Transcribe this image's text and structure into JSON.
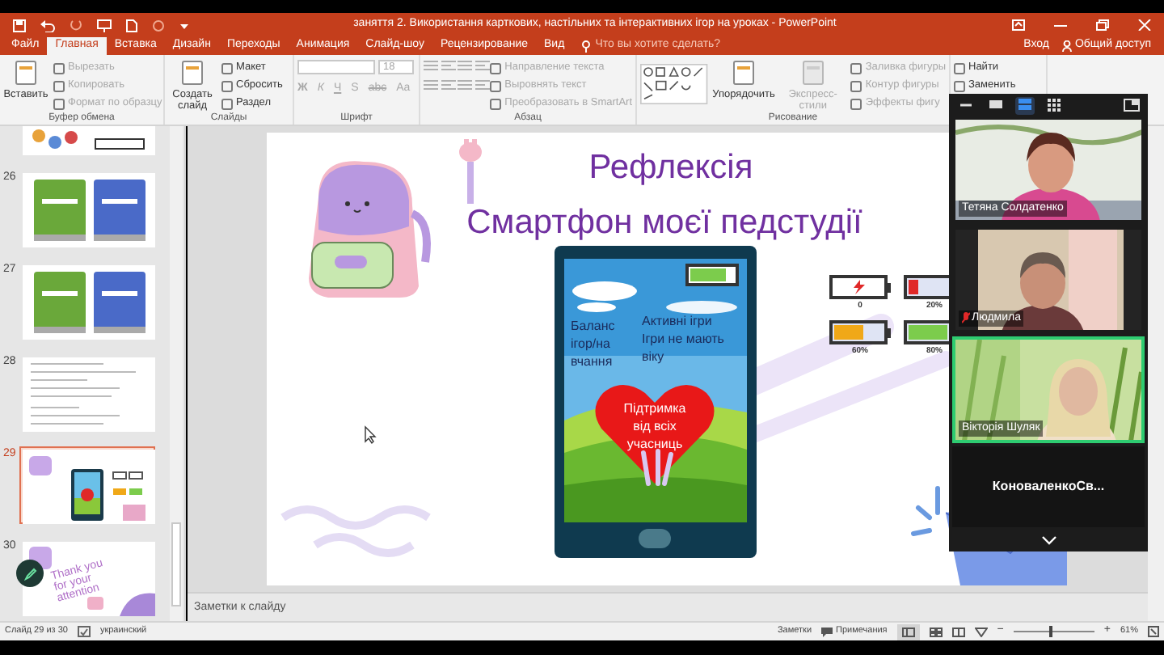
{
  "window": {
    "title": "заняття 2. Використання карткових, настільних та інтерактивних ігор на уроках  -  PowerPoint"
  },
  "tabs": [
    {
      "label": "Файл",
      "selected": false
    },
    {
      "label": "Главная",
      "selected": true
    },
    {
      "label": "Вставка",
      "selected": false
    },
    {
      "label": "Дизайн",
      "selected": false
    },
    {
      "label": "Переходы",
      "selected": false
    },
    {
      "label": "Анимация",
      "selected": false
    },
    {
      "label": "Слайд-шоу",
      "selected": false
    },
    {
      "label": "Рецензирование",
      "selected": false
    },
    {
      "label": "Вид",
      "selected": false
    }
  ],
  "tell_me": {
    "placeholder": "Что вы хотите сделать?"
  },
  "account": {
    "sign_in": "Вход",
    "share": "Общий доступ"
  },
  "ribbon": {
    "groups": [
      {
        "label": "Буфер обмена",
        "items": [
          {
            "kind": "large",
            "label": "Вставить",
            "disabled": false
          },
          {
            "kind": "small",
            "label": "Вырезать",
            "disabled": true
          },
          {
            "kind": "small",
            "label": "Копировать",
            "disabled": true
          },
          {
            "kind": "small",
            "label": "Формат по образцу",
            "disabled": true
          }
        ]
      },
      {
        "label": "Слайды",
        "items": [
          {
            "kind": "large",
            "label": "Создать слайд",
            "disabled": false
          },
          {
            "kind": "small",
            "label": "Макет",
            "disabled": false
          },
          {
            "kind": "small",
            "label": "Сбросить",
            "disabled": false
          },
          {
            "kind": "small",
            "label": "Раздел",
            "disabled": false
          }
        ]
      },
      {
        "label": "Шрифт",
        "items": [
          {
            "kind": "font",
            "size": "18",
            "glyphs": [
              "Ж",
              "К",
              "Ч",
              "S",
              "abc",
              "Aa"
            ],
            "disabled": true
          }
        ]
      },
      {
        "label": "Абзац",
        "items": [
          {
            "kind": "paragraph",
            "disabled": true
          },
          {
            "kind": "small",
            "label": "Направление текста",
            "disabled": true
          },
          {
            "kind": "small",
            "label": "Выровнять текст",
            "disabled": true
          },
          {
            "kind": "small",
            "label": "Преобразовать в SmartArt",
            "disabled": true
          }
        ]
      },
      {
        "label": "Рисование",
        "items": [
          {
            "kind": "gallery",
            "disabled": false
          },
          {
            "kind": "large",
            "label": "Упорядочить",
            "disabled": false
          },
          {
            "kind": "large",
            "label": "Экспресс-стили",
            "disabled": true
          },
          {
            "kind": "small",
            "label": "Заливка фигуры",
            "disabled": true
          },
          {
            "kind": "small",
            "label": "Контур фигуры",
            "disabled": true
          },
          {
            "kind": "small",
            "label": "Эффекты фигу",
            "disabled": true
          }
        ]
      },
      {
        "items": [
          {
            "kind": "small",
            "label": "Найти",
            "disabled": false
          },
          {
            "kind": "small",
            "label": "Заменить",
            "disabled": false
          }
        ]
      }
    ]
  },
  "thumbnails": [
    {
      "kind": "stickers",
      "selected": false
    },
    {
      "number": "26",
      "kind": "books",
      "selected": false
    },
    {
      "number": "27",
      "kind": "books",
      "selected": false
    },
    {
      "number": "28",
      "kind": "text",
      "selected": false
    },
    {
      "number": "29",
      "kind": "phone",
      "selected": true
    },
    {
      "number": "30",
      "kind": "thanks",
      "selected": false,
      "text": "Thank you for your attention"
    }
  ],
  "slide": {
    "title": "Рефлексія",
    "subtitle": "Смартфон моєї педстудії",
    "phone": {
      "level": 0.8,
      "notes": [
        {
          "lines": [
            "Баланс",
            "ігор/на",
            "вчання"
          ]
        },
        {
          "lines": [
            "Активні ігри",
            "Ігри не мають",
            "віку"
          ]
        }
      ],
      "heart": {
        "lines": [
          "Підтримка",
          "від всіх",
          "учасниць"
        ]
      }
    },
    "batteries": [
      {
        "kind": "empty",
        "label": "0",
        "color": "#e02828"
      },
      {
        "kind": "charge",
        "label": "20%",
        "level": 0.2,
        "color": "#e02828"
      },
      {
        "kind": "charge",
        "label": "60%",
        "level": 0.6,
        "color": "#f0a818"
      },
      {
        "kind": "charge",
        "label": "80%",
        "level": 0.8,
        "color": "#7ccc4c"
      }
    ]
  },
  "notes": {
    "placeholder": "Заметки к слайду"
  },
  "status_bar": {
    "slide": "Слайд 29 из 30",
    "language": "украинский",
    "notes": "Заметки",
    "comments": "Примечания",
    "zoom": "61%",
    "zoom_out": "−",
    "zoom_in": "+",
    "zoom_slider": {
      "level": 0.45
    }
  },
  "video_panel": {
    "view_modes": [
      {
        "selected": false
      },
      {
        "selected": false
      },
      {
        "selected": true
      },
      {
        "selected": false
      }
    ],
    "participants": [
      {
        "kind": "video",
        "name": "Тетяна Солдатенко",
        "muted": false,
        "active_speaker": false
      },
      {
        "kind": "video",
        "name": "Людмила",
        "muted": true,
        "active_speaker": false
      },
      {
        "kind": "video",
        "name": "Вікторія Шуляк",
        "muted": false,
        "active_speaker": true
      },
      {
        "kind": "no_video",
        "name": "КоноваленкоСв...",
        "muted": false,
        "active_speaker": false
      }
    ]
  }
}
